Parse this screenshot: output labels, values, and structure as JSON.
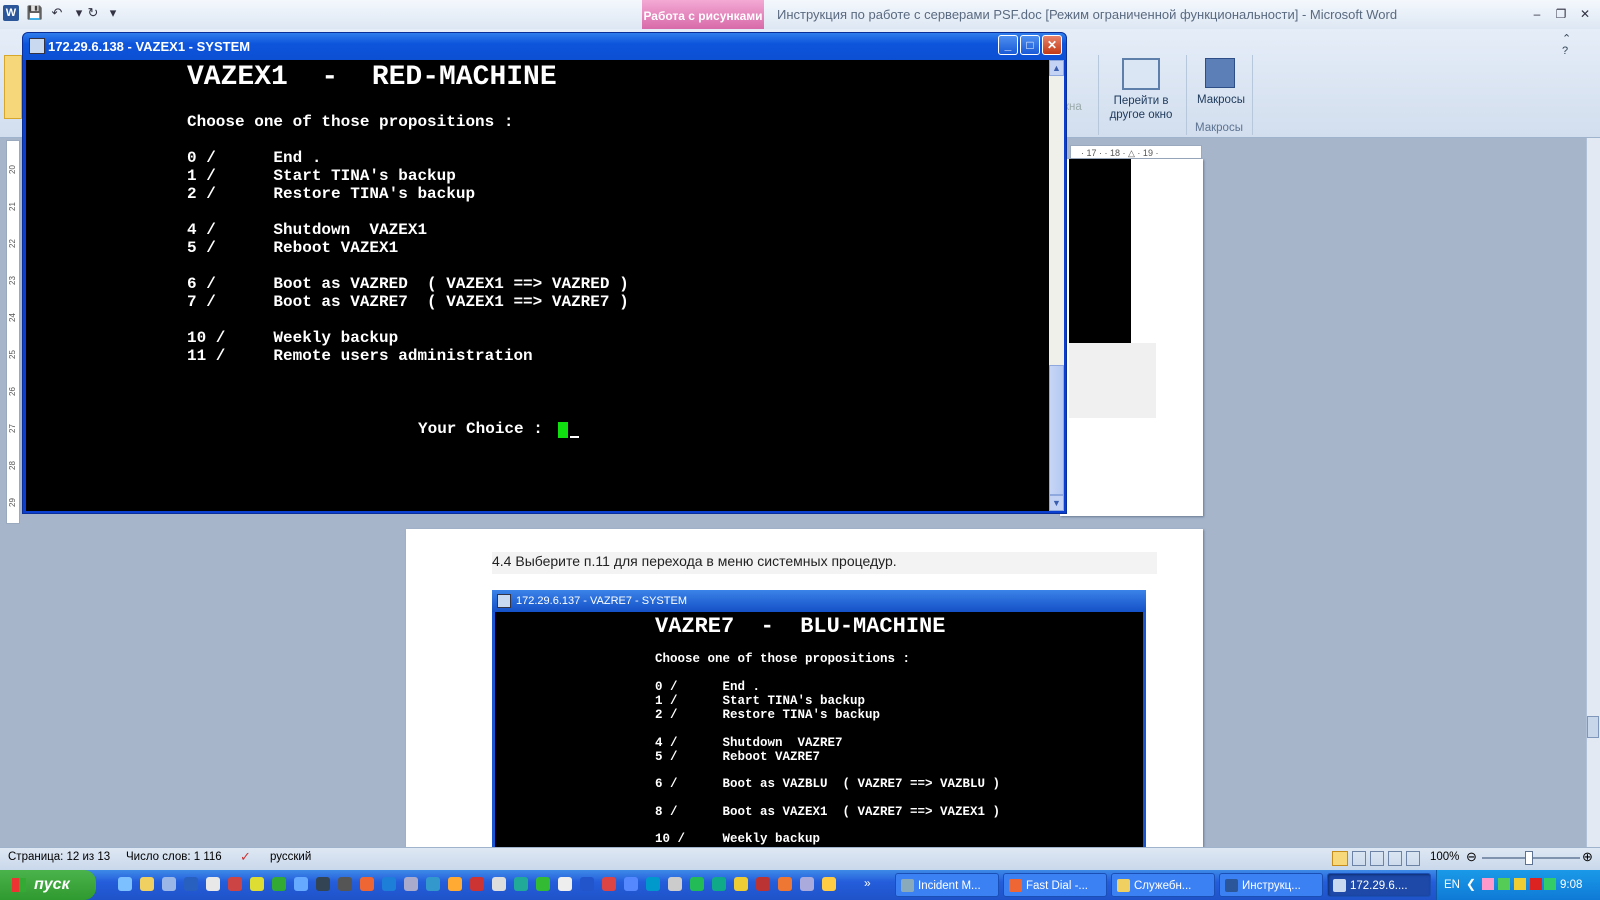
{
  "word": {
    "title": "Инструкция по работе с серверами PSF.doc [Режим ограниченной функциональности]  -  Microsoft Word",
    "context_tab": "Работа с рисунками",
    "ribbon": {
      "switch_window_label": "Перейти в другое окно",
      "macros_label": "Макросы",
      "macros_group": "Макросы",
      "faded_text": "кна"
    },
    "ruler_marks": "· 17 · · 18 · △ · 19 ·",
    "vruler_marks": [
      "20",
      "21",
      "22",
      "23",
      "24",
      "25",
      "26",
      "27",
      "28",
      "29"
    ],
    "doc_text": "4.4  Выберите п.11 для перехода в меню системных процедур.",
    "status": {
      "page": "Страница: 12 из 13",
      "words": "Число слов: 1 116",
      "lang": "русский",
      "zoom": "100%"
    }
  },
  "console": {
    "title": "172.29.6.138 - VAZEX1 - SYSTEM",
    "heading": "VAZEX1  -  RED-MACHINE",
    "prompt_intro": "Choose one of those propositions :",
    "options": [
      "0 /      End .",
      "1 /      Start TINA's backup",
      "2 /      Restore TINA's backup",
      "4 /      Shutdown  VAZEX1",
      "5 /      Reboot VAZEX1",
      "6 /      Boot as VAZRED  ( VAZEX1 ==> VAZRED )",
      "7 /      Boot as VAZRE7  ( VAZEX1 ==> VAZRE7 )",
      "10 /     Weekly backup",
      "11 /     Remote users administration"
    ],
    "your_choice": "Your Choice : "
  },
  "embedded_console": {
    "title": "172.29.6.137 - VAZRE7 - SYSTEM",
    "heading": "VAZRE7  -  BLU-MACHINE",
    "prompt_intro": "Choose one of those propositions :",
    "options": [
      "0 /      End .",
      "1 /      Start TINA's backup",
      "2 /      Restore TINA's backup",
      "4 /      Shutdown  VAZRE7",
      "5 /      Reboot VAZRE7",
      "6 /      Boot as VAZBLU  ( VAZRE7 ==> VAZBLU )",
      "8 /      Boot as VAZEX1  ( VAZRE7 ==> VAZEX1 )",
      "10 /     Weekly backup"
    ]
  },
  "taskbar": {
    "start_label": "пуск",
    "tasks": [
      "Incident M...",
      "Fast Dial -...",
      "Служебн...",
      "Инструкц...",
      "172.29.6...."
    ],
    "lang": "EN",
    "clock": "9:08"
  },
  "colors": {
    "xp_blue": "#0c4fd3",
    "cursor_green": "#10e010",
    "context_tab_pink": "#d86aa9"
  }
}
